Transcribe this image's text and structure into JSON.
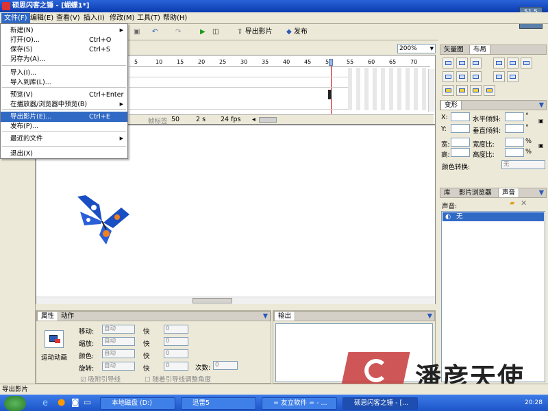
{
  "app": {
    "title": "硕思闪客之锤 - [蝴蝶1*]",
    "perf": "51.5"
  },
  "menu": {
    "items": [
      "文件(F)",
      "编辑(E)",
      "查看(V)",
      "插入(I)",
      "修改(M)",
      "工具(T)",
      "帮助(H)"
    ],
    "file_menu": [
      {
        "label": "新建(N)",
        "shortcut": "",
        "arrow": "▶"
      },
      {
        "label": "打开(O)...",
        "shortcut": "Ctrl+O",
        "arrow": ""
      },
      {
        "label": "保存(S)",
        "shortcut": "Ctrl+S",
        "arrow": ""
      },
      {
        "label": "另存为(A)...",
        "shortcut": "",
        "arrow": ""
      },
      {
        "label": "导入(I)...",
        "shortcut": "",
        "arrow": ""
      },
      {
        "label": "导入到库(L)...",
        "shortcut": "",
        "arrow": ""
      },
      {
        "label": "预览(V)",
        "shortcut": "Ctrl+Enter",
        "arrow": ""
      },
      {
        "label": "在播放器/浏览器中预览(B)",
        "shortcut": "",
        "arrow": "▶"
      },
      {
        "label": "导出影片(E)...",
        "shortcut": "Ctrl+E",
        "arrow": ""
      },
      {
        "label": "发布(P)...",
        "shortcut": "",
        "arrow": ""
      },
      {
        "label": "最近的文件",
        "shortcut": "",
        "arrow": "▶"
      },
      {
        "label": "退出(X)",
        "shortcut": "",
        "arrow": ""
      }
    ]
  },
  "toolbar": {
    "export_label": "导出影片",
    "publish_label": "发布",
    "zoom": "200%"
  },
  "timeline": {
    "ticks": [
      "5",
      "10",
      "15",
      "20",
      "25",
      "30",
      "35",
      "40",
      "45",
      "50",
      "55",
      "60",
      "65",
      "70"
    ],
    "frame_label_placeholder": "帧标签",
    "frame": "50",
    "time": "2 s",
    "fps": "24 fps"
  },
  "right": {
    "tabs": [
      "矢量图",
      "布局"
    ],
    "transform_title": "变形",
    "x_label": "X:",
    "y_label": "Y:",
    "h_skew": "水平倾斜:",
    "v_skew": "垂直倾斜:",
    "width": "宽:",
    "height": "高:",
    "w_ratio": "宽度比:",
    "h_ratio": "高度比:",
    "deg": "°",
    "pct": "%",
    "color_transform": "颜色转换:",
    "color_value": "无",
    "lib_tabs": [
      "库",
      "影片浏览器",
      "声音"
    ],
    "sound_label": "声音:",
    "sound_value": "无"
  },
  "props": {
    "tabs": [
      "属性",
      "动作"
    ],
    "anim_label": "运动动画",
    "rows": [
      {
        "label": "移动:",
        "value": "自动",
        "speed_label": "快",
        "speed": "0"
      },
      {
        "label": "缩放:",
        "value": "自动",
        "speed_label": "快",
        "speed": "0"
      },
      {
        "label": "颜色:",
        "value": "自动",
        "speed_label": "快",
        "speed": "0"
      },
      {
        "label": "旋转:",
        "value": "自动",
        "speed_label": "快",
        "speed": "0"
      }
    ],
    "times_label": "次数:",
    "times_value": "0",
    "snap_guide": "吸附引导线",
    "follow_guide": "随着引导线调整角度"
  },
  "output": {
    "title": "输出"
  },
  "status": {
    "text": "导出影片"
  },
  "taskbar": {
    "items": [
      "本地磁盘 (D:)",
      "迅雷5",
      "= 友立软件 = - ...",
      "硕思闪客之锤 - [..."
    ],
    "clock": "20:28"
  },
  "watermark": {
    "text": "潘彦天使"
  }
}
